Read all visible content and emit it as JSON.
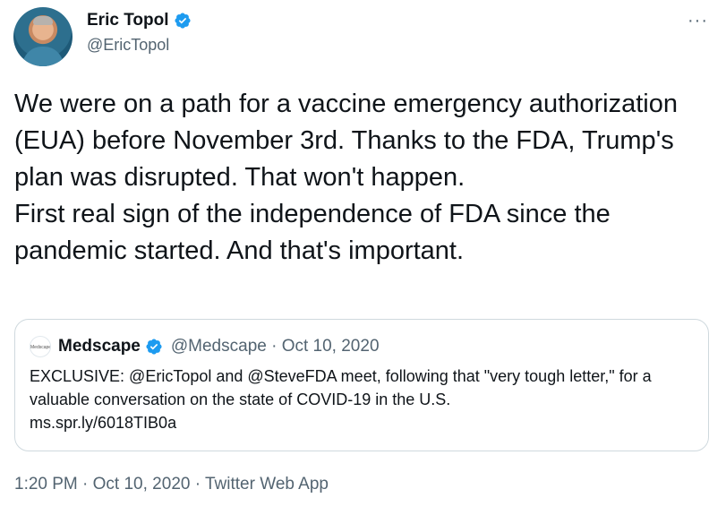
{
  "author": {
    "name": "Eric Topol",
    "handle": "@EricTopol"
  },
  "tweet": {
    "paragraph1": "We were on a path for a vaccine emergency authorization (EUA) before November 3rd. Thanks to the FDA, Trump's plan was disrupted. That won't happen.",
    "paragraph2": "First real sign of the independence of FDA since the pandemic started. And that's important."
  },
  "quote": {
    "logo_text": "Medscape",
    "name": "Medscape",
    "handle_date": "@Medscape · Oct 10, 2020",
    "text": "EXCLUSIVE: @EricTopol and @SteveFDA meet, following that \"very tough letter,\" for a valuable conversation on the state of COVID-19 in the U.S.",
    "link": "ms.spr.ly/6018TIB0a"
  },
  "footer": {
    "time": "1:20 PM",
    "date": "Oct 10, 2020",
    "source": "Twitter Web App",
    "separator": " · "
  },
  "menu": {
    "more_label": "···"
  },
  "colors": {
    "verified": "#1d9bf0",
    "secondary_text": "#536471",
    "border": "#cfd9de"
  }
}
